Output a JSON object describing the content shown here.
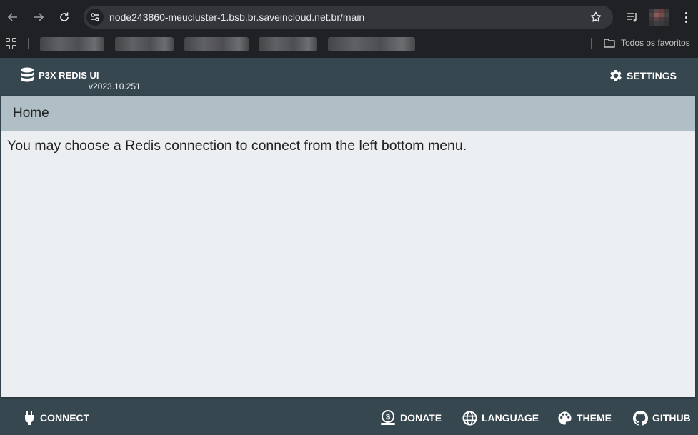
{
  "browser": {
    "url": "node243860-meucluster-1.bsb.br.saveincloud.net.br/main",
    "all_bookmarks_label": "Todos os favoritos"
  },
  "header": {
    "app_name": "P3X REDIS UI",
    "version": "v2023.10.251",
    "settings_label": "SETTINGS"
  },
  "main": {
    "title": "Home",
    "message": "You may choose a Redis connection to connect from the left bottom menu."
  },
  "footer": {
    "connect_label": "CONNECT",
    "donate_label": "DONATE",
    "language_label": "LANGUAGE",
    "theme_label": "THEME",
    "github_label": "GITHUB"
  },
  "icons": {
    "back": "arrow-left-icon",
    "forward": "arrow-right-icon",
    "reload": "reload-icon",
    "site_info": "tune-icon",
    "bookmark": "star-icon",
    "media": "media-controls-icon",
    "menu": "vertical-dots-icon",
    "apps": "apps-grid-icon",
    "folder": "folder-icon",
    "database": "database-icon",
    "settings": "gear-icon",
    "connect": "power-plug-icon",
    "donate": "money-bag-icon",
    "language": "globe-icon",
    "theme": "palette-icon",
    "github": "github-icon"
  },
  "colors": {
    "browser_bg": "#202124",
    "omnibox_bg": "#35363a",
    "app_bar": "#37474f",
    "card_header": "#b0bec5",
    "card_body": "#eceff1"
  }
}
